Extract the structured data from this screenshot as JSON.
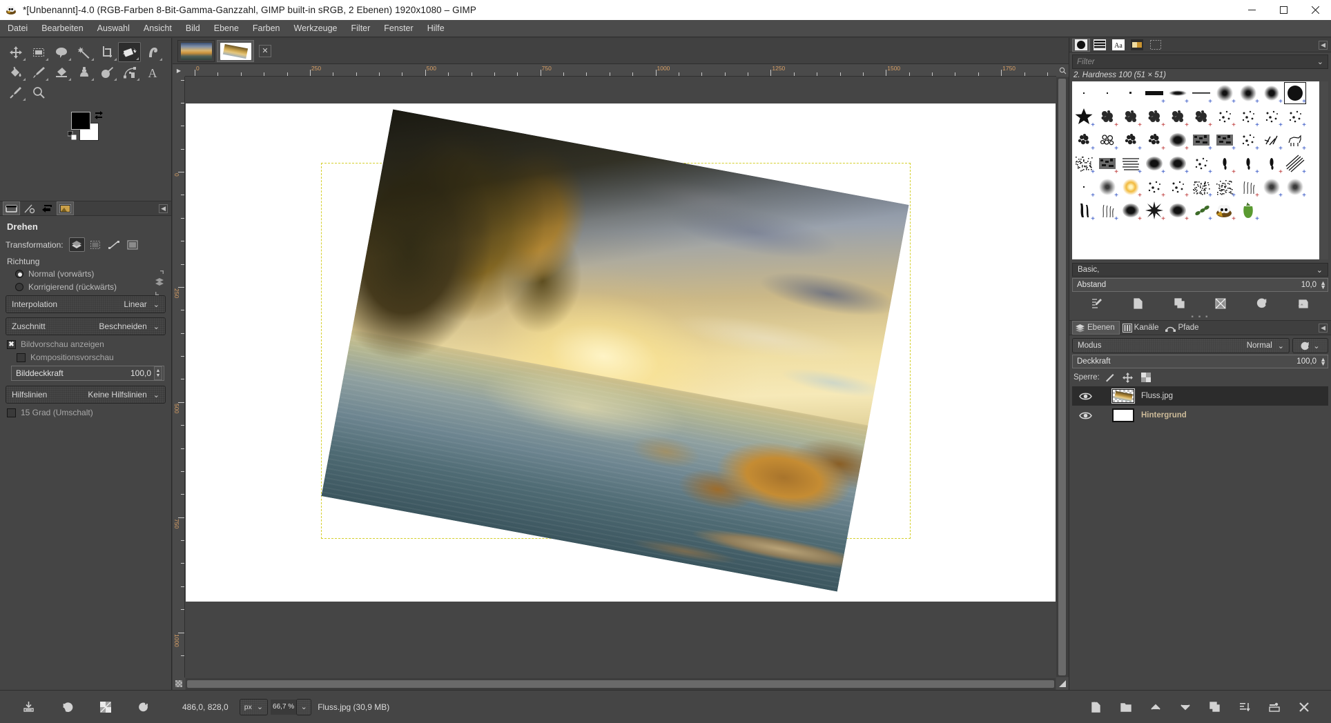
{
  "titlebar": {
    "title": "*[Unbenannt]-4.0 (RGB-Farben 8-Bit-Gamma-Ganzzahl, GIMP built-in sRGB, 2 Ebenen) 1920x1080 – GIMP",
    "app_icon": "gimp-wilber-icon",
    "minimize": "–",
    "maximize": "❐",
    "close": "✕"
  },
  "menubar": {
    "items": [
      {
        "label": "Datei",
        "name": "menu-datei"
      },
      {
        "label": "Bearbeiten",
        "name": "menu-bearbeiten"
      },
      {
        "label": "Auswahl",
        "name": "menu-auswahl"
      },
      {
        "label": "Ansicht",
        "name": "menu-ansicht"
      },
      {
        "label": "Bild",
        "name": "menu-bild"
      },
      {
        "label": "Ebene",
        "name": "menu-ebene"
      },
      {
        "label": "Farben",
        "name": "menu-farben"
      },
      {
        "label": "Werkzeuge",
        "name": "menu-werkzeuge"
      },
      {
        "label": "Filter",
        "name": "menu-filter"
      },
      {
        "label": "Fenster",
        "name": "menu-fenster"
      },
      {
        "label": "Hilfe",
        "name": "menu-hilfe"
      }
    ]
  },
  "toolbox": {
    "tools": [
      {
        "name": "move-tool-icon",
        "selected": false
      },
      {
        "name": "rectangle-select-tool-icon",
        "selected": false
      },
      {
        "name": "free-select-tool-icon",
        "selected": false
      },
      {
        "name": "fuzzy-select-tool-icon",
        "selected": false
      },
      {
        "name": "crop-tool-icon",
        "selected": false
      },
      {
        "name": "rotate-transform-tool-icon",
        "selected": true
      },
      {
        "name": "warp-transform-tool-icon",
        "selected": false
      },
      {
        "name": "bucket-fill-tool-icon",
        "selected": false
      },
      {
        "name": "paintbrush-tool-icon",
        "selected": false
      },
      {
        "name": "eraser-tool-icon",
        "selected": false
      },
      {
        "name": "clone-tool-icon",
        "selected": false
      },
      {
        "name": "smudge-tool-icon",
        "selected": false
      },
      {
        "name": "paths-tool-icon",
        "selected": false
      },
      {
        "name": "text-tool-icon",
        "selected": false
      },
      {
        "name": "color-picker-tool-icon",
        "selected": false
      },
      {
        "name": "zoom-tool-icon",
        "selected": false
      }
    ],
    "foreground_color": "#000000",
    "background_color": "#ffffff"
  },
  "tool_options": {
    "tabs": [
      {
        "name": "tool-options-tab",
        "selected": true
      },
      {
        "name": "device-status-tab",
        "selected": false
      },
      {
        "name": "undo-history-tab",
        "selected": false
      },
      {
        "name": "images-tab",
        "selected": true
      }
    ],
    "title": "Drehen",
    "transformation_label": "Transformation:",
    "transformation_buttons": [
      {
        "name": "transform-layer-button",
        "selected": true
      },
      {
        "name": "transform-selection-button",
        "selected": false
      },
      {
        "name": "transform-path-button",
        "selected": false
      },
      {
        "name": "transform-image-button",
        "selected": false
      }
    ],
    "direction_label": "Richtung",
    "direction_options": [
      {
        "label": "Normal (vorwärts)",
        "selected": true
      },
      {
        "label": "Korrigierend (rückwärts)",
        "selected": false
      }
    ],
    "interpolation_label": "Interpolation",
    "interpolation_value": "Linear",
    "clipping_label": "Zuschnitt",
    "clipping_value": "Beschneiden",
    "preview_label": "Bildvorschau anzeigen",
    "preview_checked": true,
    "composited_label": "Kompositionsvorschau",
    "composited_checked": false,
    "opacity_label": "Bilddeckkraft",
    "opacity_value": "100,0",
    "guides_label": "Hilfslinien",
    "guides_value": "Keine Hilfslinien",
    "constrain_label": "15 Grad (Umschalt)",
    "constrain_checked": false
  },
  "canvas": {
    "tabs": [
      {
        "name": "image-tab-original",
        "selected": false
      },
      {
        "name": "image-tab-rotated",
        "selected": true
      }
    ],
    "tab_close_label": "✕",
    "ruler_h_labels": [
      "0",
      "250",
      "500",
      "750",
      "1000",
      "1250",
      "1500",
      "1750"
    ],
    "ruler_v_labels": [
      "0",
      "250",
      "500",
      "750",
      "1000"
    ],
    "zoom_corner_icon": "menu-arrow-icon",
    "zoom_magnifier_icon": "zoom-icon",
    "quickmask_icon": "quick-mask-icon",
    "navigation_icon": "navigation-icon"
  },
  "brushes": {
    "tabs": [
      {
        "name": "brushes-tab",
        "selected": true
      },
      {
        "name": "patterns-tab",
        "selected": false
      },
      {
        "name": "fonts-tab",
        "selected": false
      },
      {
        "name": "gradients-tab",
        "selected": false
      },
      {
        "name": "palettes-tab",
        "selected": false
      }
    ],
    "filter_placeholder": "Filter",
    "selected_brush": "2. Hardness 100 (51 × 51)",
    "tag_value": "Basic,",
    "spacing_label": "Abstand",
    "spacing_value": "10,0",
    "buttons": [
      {
        "name": "edit-brush-button"
      },
      {
        "name": "new-brush-button"
      },
      {
        "name": "duplicate-brush-button"
      },
      {
        "name": "delete-brush-button"
      },
      {
        "name": "refresh-brushes-button"
      },
      {
        "name": "open-brush-as-image-button"
      }
    ]
  },
  "layers": {
    "tabs": [
      {
        "label": "Ebenen",
        "name": "tab-ebenen",
        "selected": true
      },
      {
        "label": "Kanäle",
        "name": "tab-kanaele",
        "selected": false
      },
      {
        "label": "Pfade",
        "name": "tab-pfade",
        "selected": false
      }
    ],
    "mode_label": "Modus",
    "mode_value": "Normal",
    "opacity_label": "Deckkraft",
    "opacity_value": "100,0",
    "lock_label": "Sperre:",
    "lock_buttons": [
      {
        "name": "lock-pixels-button"
      },
      {
        "name": "lock-position-button"
      },
      {
        "name": "lock-alpha-button"
      }
    ],
    "items": [
      {
        "name": "layer-row-fluss",
        "label": "Fluss.jpg",
        "visible": true,
        "selected": true,
        "bold": false
      },
      {
        "name": "layer-row-hintergrund",
        "label": "Hintergrund",
        "visible": true,
        "selected": false,
        "bold": true
      }
    ],
    "bottom_buttons": [
      {
        "name": "new-layer-button"
      },
      {
        "name": "new-layer-group-button"
      },
      {
        "name": "raise-layer-button"
      },
      {
        "name": "lower-layer-button"
      },
      {
        "name": "duplicate-layer-button"
      },
      {
        "name": "anchor-layer-button"
      },
      {
        "name": "merge-down-button"
      },
      {
        "name": "delete-layer-button"
      }
    ]
  },
  "statusbar": {
    "position": "486,0, 828,0",
    "unit": "px",
    "zoom": "66,7 %",
    "status_text": "Fluss.jpg (30,9 MB)"
  },
  "left_bottom": {
    "buttons": [
      {
        "name": "save-tool-options-button"
      },
      {
        "name": "restore-tool-options-button"
      },
      {
        "name": "delete-tool-options-button"
      },
      {
        "name": "reset-tool-options-button"
      }
    ]
  }
}
